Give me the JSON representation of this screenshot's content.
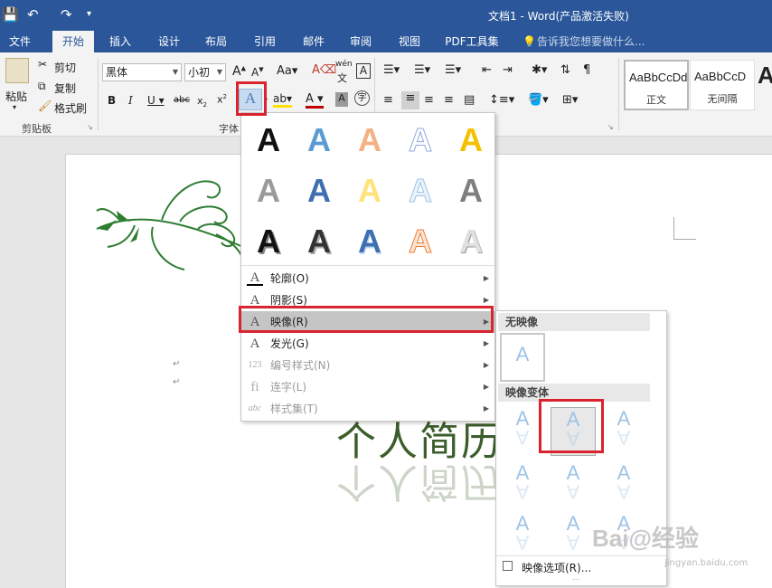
{
  "window": {
    "title": "文档1 - Word(产品激活失败)"
  },
  "quick_access": {
    "save": "💾",
    "undo": "↶",
    "redo": "↷",
    "customize": "▾"
  },
  "tabs": [
    "文件",
    "开始",
    "插入",
    "设计",
    "布局",
    "引用",
    "邮件",
    "审阅",
    "视图",
    "PDF工具集",
    "告诉我您想要做什么..."
  ],
  "ribbon": {
    "clipboard": {
      "paste": "粘贴",
      "cut": "剪切",
      "copy": "复制",
      "format_painter": "格式刷",
      "group_label": "剪贴板"
    },
    "font": {
      "font_name": "黑体",
      "font_size": "小初",
      "group_label": "字体",
      "phonetic": "wén"
    },
    "styles": [
      {
        "preview": "AaBbCcDd",
        "name": "正文"
      },
      {
        "preview": "AaBbCcD",
        "name": "无间隔"
      }
    ]
  },
  "text_effects_menu": {
    "items": [
      {
        "label": "轮廓(O)",
        "icon": "A",
        "enabled": true
      },
      {
        "label": "阴影(S)",
        "icon": "A",
        "enabled": true
      },
      {
        "label": "映像(R)",
        "icon": "A",
        "enabled": true,
        "highlighted": true
      },
      {
        "label": "发光(G)",
        "icon": "A",
        "enabled": true
      },
      {
        "label": "编号样式(N)",
        "icon": "123",
        "enabled": false
      },
      {
        "label": "连字(L)",
        "icon": "fi",
        "enabled": false
      },
      {
        "label": "样式集(T)",
        "icon": "abc",
        "enabled": false
      }
    ]
  },
  "reflection_submenu": {
    "no_reflection_header": "无映像",
    "variations_header": "映像变体",
    "options": "映像选项(R)..."
  },
  "document": {
    "text": "个人简历"
  },
  "watermark": {
    "brand": "Bai@经验",
    "url": "jingyan.baidu.com"
  }
}
